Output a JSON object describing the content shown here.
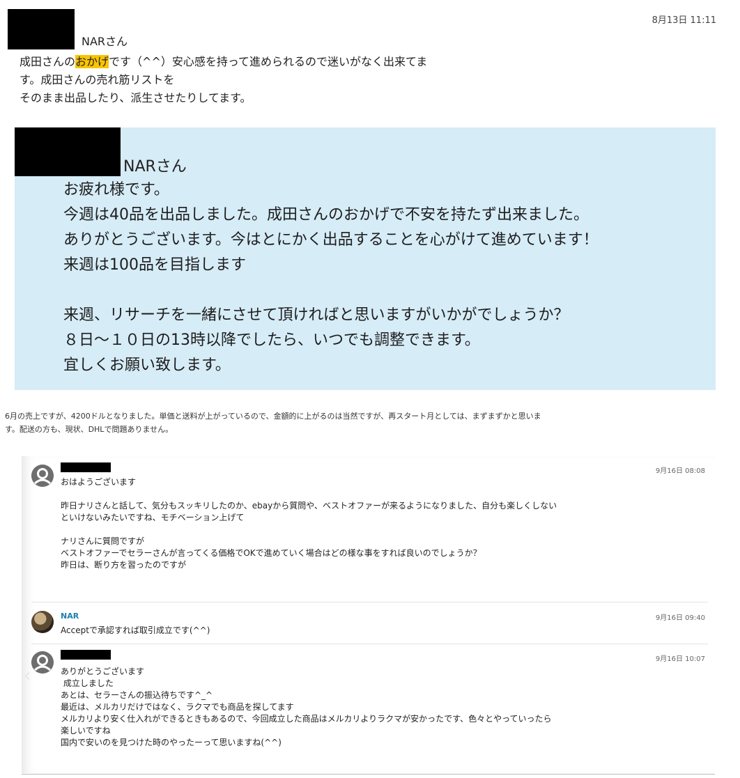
{
  "message1": {
    "recipient": "NARさん",
    "timestamp": "8月13日 11:11",
    "line1_before": "成田さんの",
    "line1_highlight": "おかげ",
    "line1_after": "です（^^）安心感を持って進められるので迷いがなく出来てま",
    "line2": "す。成田さんの売れ筋リストを",
    "line3": "そのまま出品したり、派生させたりしてます。"
  },
  "message2": {
    "recipient": "NARさん",
    "lines": [
      "お疲れ様です。",
      "今週は40品を出品しました。成田さんのおかげで不安を持たず出来ました。",
      "ありがとうございます。今はとにかく出品することを心がけて進めています！",
      "来週は100品を目指します"
    ],
    "lines2": [
      "来週、リサーチを一緒にさせて頂ければと思いますがいかがでしょうか？",
      "８日～１０日の13時以降でしたら、いつでも調整できます。",
      "宜しくお願い致します。"
    ]
  },
  "sales_note": {
    "line1": "6月の売上ですが、4200ドルとなりました。単価と送料が上がっているので、金額的に上がるのは当然ですが、再スタート月としては、まずまずかと思いま",
    "line2": "す。配送の方も、現状、DHLで問題ありません。"
  },
  "chat": {
    "items": [
      {
        "author": "",
        "time": "9月16日 08:08",
        "avatar": "default-user-icon",
        "lines": [
          "おはようございます",
          "",
          "昨日ナリさんと話して、気分もスッキリしたのか、ebayから質問や、ベストオファーが来るようになりました、自分も楽しくしない",
          "といけないみたいですね、モチベーション上げて",
          "",
          "ナリさんに質問ですが",
          "ベストオファーでセラーさんが言ってくる価格でOKで進めていく場合はどの様な事をすれば良いのでしょうか？",
          "昨日は、断り方を習ったのですが"
        ]
      },
      {
        "author": "NAR",
        "time": "9月16日 09:40",
        "avatar": "photo-avatar",
        "lines": [
          "Acceptで承認すれば取引成立です(^^)"
        ]
      },
      {
        "author": "",
        "time": "9月16日 10:07",
        "avatar": "default-user-icon",
        "lines": [
          "ありがとうございます",
          " 成立しました",
          "あとは、セラーさんの振込待ちです^_^",
          "最近は、メルカリだけではなく、ラクマでも商品を探してます",
          "メルカリより安く仕入れができるときもあるので、今回成立した商品はメルカリよりラクマが安かったです、色々とやっていったら",
          "楽しいですね",
          "国内で安いのを見つけた時のやったーって思いますね(^^)"
        ]
      }
    ]
  },
  "colors": {
    "highlight": "#f9c400",
    "quote_background": "#d6ecf7",
    "author_link": "#1b7fb0"
  }
}
